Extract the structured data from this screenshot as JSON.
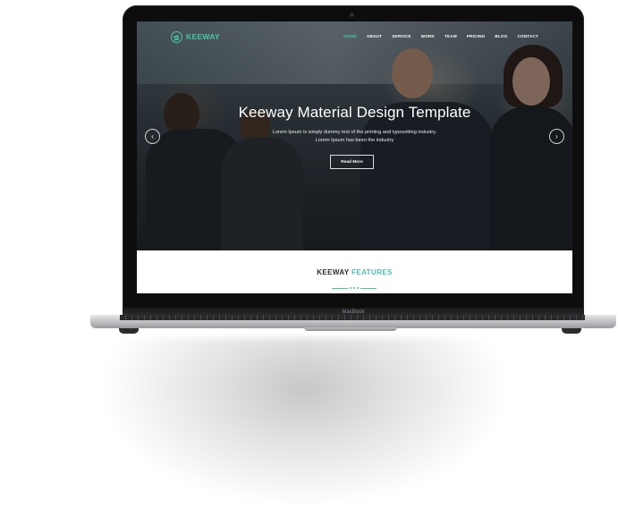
{
  "site": {
    "logo_text": "KEEWAY",
    "nav": [
      "HOME",
      "ABOUT",
      "SERVICE",
      "WORK",
      "TEAM",
      "PRICING",
      "BLOG",
      "CONTACT"
    ],
    "active_nav": "HOME"
  },
  "hero": {
    "title": "Keeway Material Design Template",
    "subtitle_line1": "Lorem Ipsum is simply dummy text of the printing and typesetting industry.",
    "subtitle_line2": "Lorem Ipsum has been the industry",
    "button": "Read More",
    "prev_arrow": "‹",
    "next_arrow": "›"
  },
  "features": {
    "title_part1": "KEEWAY",
    "title_part2": "FEATURES"
  },
  "device": {
    "label": "MacBook"
  },
  "colors": {
    "accent": "#48c7a6",
    "lid": "#0d0d0e"
  },
  "icons": {
    "logo": "keeway-logo-icon",
    "prev": "chevron-left-icon",
    "next": "chevron-right-icon"
  }
}
